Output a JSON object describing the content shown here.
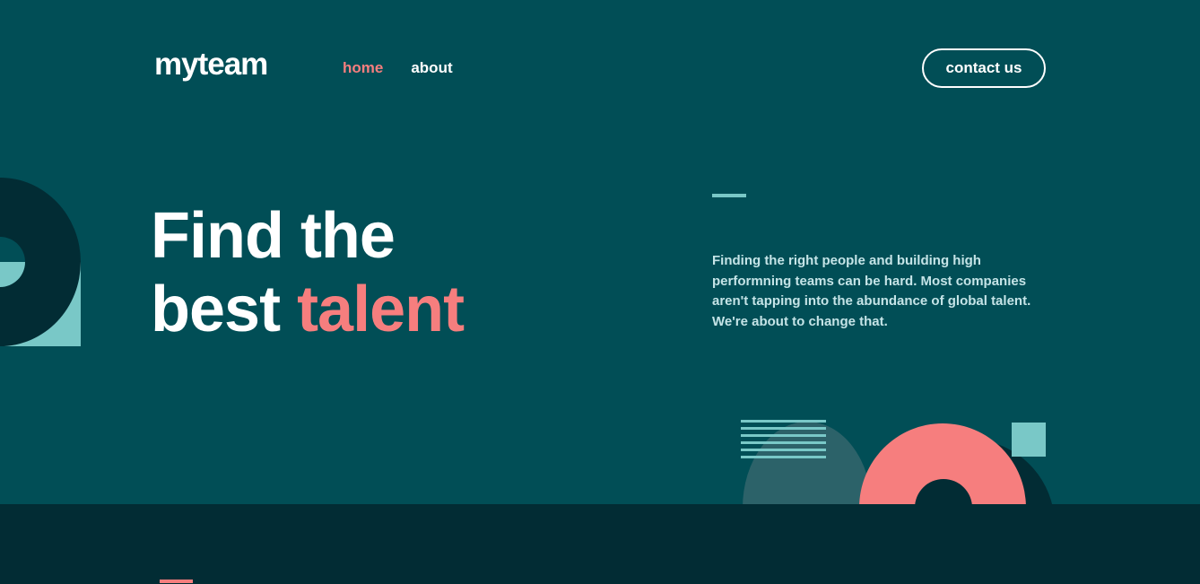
{
  "header": {
    "logo": "myteam",
    "nav": [
      {
        "label": "home",
        "active": true
      },
      {
        "label": "about",
        "active": false
      }
    ],
    "contact_label": "contact us"
  },
  "hero": {
    "title_line1": "Find the",
    "title_line2_prefix": "best",
    "title_line2_accent": "talent",
    "description": "Finding the right people and building high performning teams can be hard. Most companies aren't tapping into the abundance of global talent. We're about to change that."
  },
  "colors": {
    "background": "#014e56",
    "dark": "#022c34",
    "coral": "#f67e7e",
    "light_teal": "#79c8c7",
    "text_light": "#c5e4e7",
    "white": "#ffffff"
  },
  "icons": [
    "decorative-circle-left",
    "decorative-lines",
    "decorative-semicircle",
    "decorative-ring",
    "decorative-square"
  ]
}
